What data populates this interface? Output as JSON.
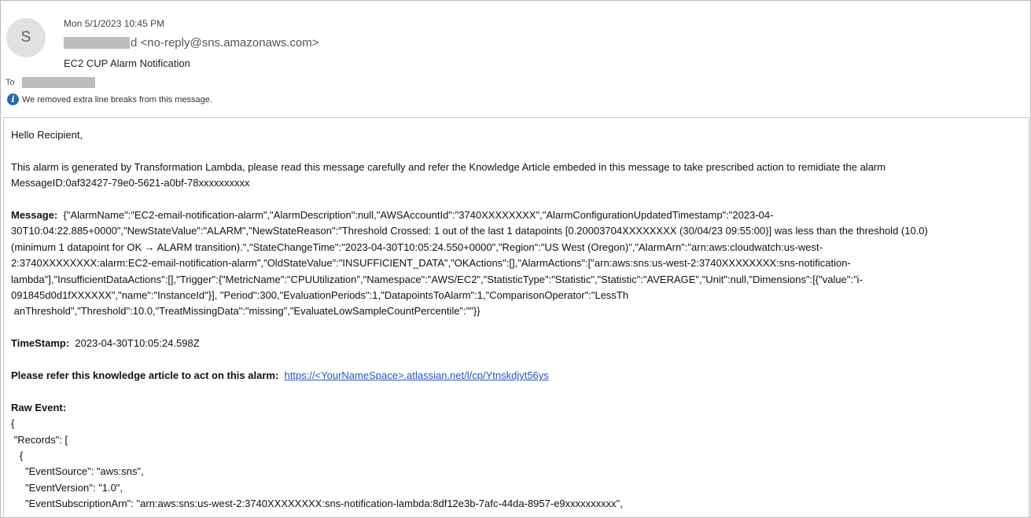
{
  "header": {
    "avatar_letter": "S",
    "date": "Mon 5/1/2023 10:45 PM",
    "from_suffix": "d",
    "from_address": "<no-reply@sns.amazonaws.com>",
    "subject": "EC2 CUP Alarm Notification",
    "to_label": "To",
    "info_text": "We removed extra line breaks from this message."
  },
  "body": {
    "greeting": "Hello Recipient,",
    "intro_line1": "This alarm is generated by Transformation Lambda, please read this message carefully and refer the Knowledge Article embeded in this message to take prescribed action to remidiate the alarm",
    "intro_line2": "MessageID:0af32427-79e0-5621-a0bf-78xxxxxxxxxx",
    "message_label": "Message:",
    "message_lines": [
      "{\"AlarmName\":\"EC2-email-notification-alarm\",\"AlarmDescription\":null,\"AWSAccountId\":\"3740XXXXXXXX\",\"AlarmConfigurationUpdatedTimestamp\":\"2023-04-",
      "30T10:04:22.885+0000\",\"NewStateValue\":\"ALARM\",\"NewStateReason\":\"Threshold Crossed: 1 out of the last 1 datapoints [0.20003704XXXXXXXX (30/04/23 09:55:00)] was less than the threshold (10.0)",
      "(minimum 1 datapoint for OK → ALARM transition).\",\"StateChangeTime\":\"2023-04-30T10:05:24.550+0000\",\"Region\":\"US West (Oregon)\",\"AlarmArn\":\"arn:aws:cloudwatch:us-west-",
      "2:3740XXXXXXXX:alarm:EC2-email-notification-alarm\",\"OldStateValue\":\"INSUFFICIENT_DATA\",\"OKActions\":[],\"AlarmActions\":[\"arn:aws:sns:us-west-2:3740XXXXXXXX:sns-notification-",
      "lambda\"],\"InsufficientDataActions\":[],\"Trigger\":{\"MetricName\":\"CPUUtilization\",\"Namespace\":\"AWS/EC2\",\"StatisticType\":\"Statistic\",\"Statistic\":\"AVERAGE\",\"Unit\":null,\"Dimensions\":[{\"value\":\"i-",
      "091845d0d1fXXXXXX\",\"name\":\"InstanceId\"}], \"Period\":300,\"EvaluationPeriods\":1,\"DatapointsToAlarm\":1,\"ComparisonOperator\":\"LessTh",
      " anThreshold\",\"Threshold\":10.0,\"TreatMissingData\":\"missing\",\"EvaluateLowSampleCountPercentile\":\"\"}}"
    ],
    "timestamp_label": "TimeStamp:",
    "timestamp_value": "2023-04-30T10:05:24.598Z",
    "kb_label": "Please refer this knowledge article to act on this alarm:",
    "kb_link": "https://<YourNameSpace>.atlassian.net/l/cp/Ytnskdjyt56ys",
    "raw_label": "Raw Event:",
    "raw_lines": [
      "{",
      " \"Records\": [",
      "   {",
      "     \"EventSource\": \"aws:sns\",",
      "     \"EventVersion\": \"1.0\",",
      "     \"EventSubscriptionArn\": \"arn:aws:sns:us-west-2:3740XXXXXXXX:sns-notification-lambda:8df12e3b-7afc-44da-8957-e9xxxxxxxxxx\","
    ]
  }
}
